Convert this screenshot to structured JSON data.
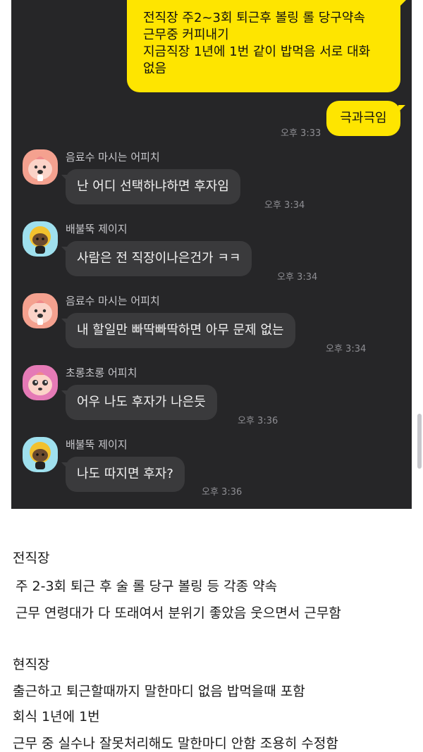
{
  "chat": {
    "my_message_1": {
      "lines": [
        "전직장 주2~3회 퇴근후 볼링 롤 당구약속",
        "근무중 커피내기",
        "지금직장 1년에 1번 같이 밥먹음 서로 대화",
        "없음"
      ]
    },
    "my_message_2": {
      "text": "극과극임",
      "time": "오후 3:33"
    },
    "messages": [
      {
        "sender": "음료수 마시는 어피치",
        "text": "난 어디 선택하냐하면 후자임",
        "time": "오후 3:34",
        "avatar": "apeach-drink-avatar"
      },
      {
        "sender": "배불뚝 제이지",
        "text": "사람은 전 직장이나은건가 ㅋㅋ",
        "time": "오후 3:34",
        "avatar": "jayg-avatar"
      },
      {
        "sender": "음료수 마시는 어피치",
        "text": "내 할일만 빠딱빠딱하면 아무 문제 없는",
        "time": "오후 3:34",
        "avatar": "apeach-drink-avatar"
      },
      {
        "sender": "초롱초롱 어피치",
        "text": "어우 나도 후자가 나은듯",
        "time": "오후 3:36",
        "avatar": "apeach-sparkle-avatar"
      },
      {
        "sender": "배불뚝 제이지",
        "text": "나도 따지면 후자?",
        "time": "오후 3:36",
        "avatar": "jayg-avatar"
      }
    ]
  },
  "post": {
    "lines": [
      "전직장",
      "주 2-3회 퇴근 후 술 롤 당구 볼링 등 각종 약속",
      "근무 연령대가 다 또래여서 분위기 좋았음 웃으면서 근무함",
      "현직장",
      "출근하고 퇴근할때까지 말한마디 없음 밥먹을때 포함",
      "회식 1년에 1번",
      "근무 중 실수나 잘못처리해도 말한마디 안함 조용히 수정함"
    ]
  },
  "colors": {
    "chat_bg": "#262628",
    "my_bubble": "#fee500",
    "their_bubble": "#3a3a3c"
  }
}
